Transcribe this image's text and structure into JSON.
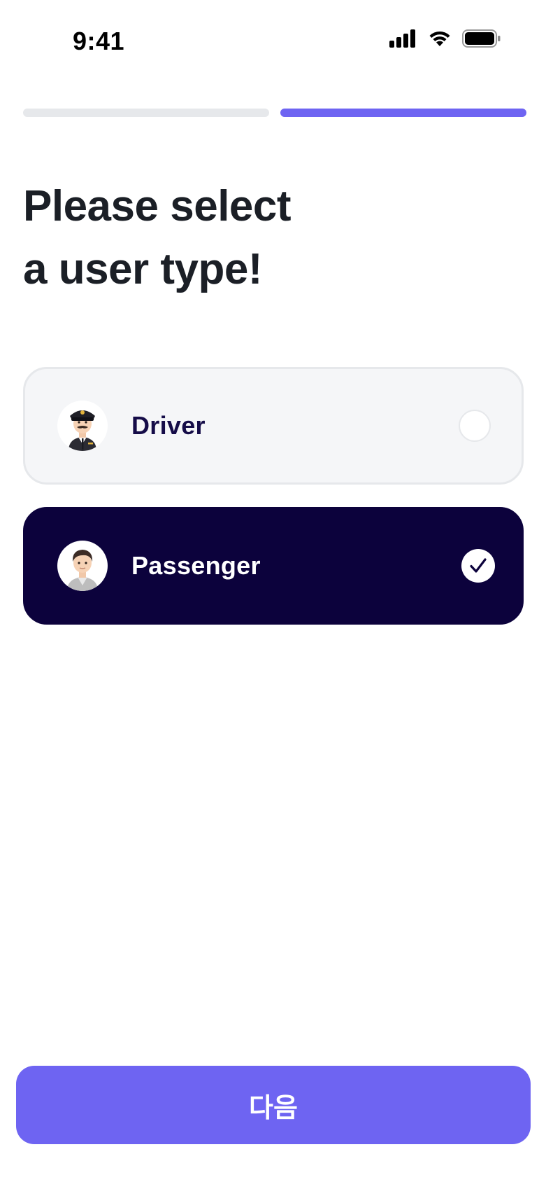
{
  "status_bar": {
    "time": "9:41",
    "icons": [
      "cellular-signal-icon",
      "wifi-icon",
      "battery-icon"
    ]
  },
  "progress": {
    "total_steps": 2,
    "current_step": 2
  },
  "title": {
    "line1": "Please select",
    "line2": "a user type!"
  },
  "options": [
    {
      "label": "Driver",
      "icon": "pilot-avatar-icon",
      "selected": false
    },
    {
      "label": "Passenger",
      "icon": "person-avatar-icon",
      "selected": true
    }
  ],
  "next_button": {
    "label": "다음"
  },
  "colors": {
    "accent": "#6e64f2",
    "selected_bg": "#0c023c",
    "unselected_bg": "#f5f6f8",
    "title_text": "#1b1f26"
  }
}
